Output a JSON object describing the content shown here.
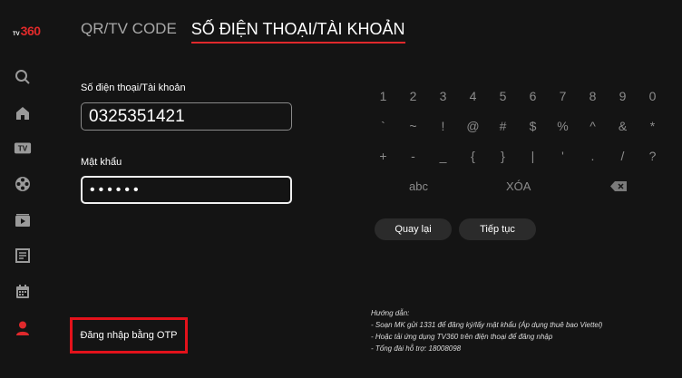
{
  "logo": {
    "prefix": "TV",
    "number": "360"
  },
  "sidebar": {
    "items": [
      {
        "icon": "search-icon",
        "active": false
      },
      {
        "icon": "home-icon",
        "active": false
      },
      {
        "icon": "tv-icon",
        "active": false
      },
      {
        "icon": "film-reel-icon",
        "active": false
      },
      {
        "icon": "video-icon",
        "active": false
      },
      {
        "icon": "news-icon",
        "active": false
      },
      {
        "icon": "calendar-icon",
        "active": false
      },
      {
        "icon": "user-icon",
        "active": true
      }
    ],
    "active_color": "#e0292c"
  },
  "tabs": [
    {
      "label": "QR/TV CODE",
      "active": false
    },
    {
      "label": "SỐ ĐIỆN THOẠI/TÀI KHOẢN",
      "active": true
    }
  ],
  "form": {
    "phone_label": "Số điện thoại/Tài khoản",
    "phone_value": "0325351421",
    "password_label": "Mật khẩu",
    "password_value": "••••••"
  },
  "keyboard": {
    "rows": [
      [
        "1",
        "2",
        "3",
        "4",
        "5",
        "6",
        "7",
        "8",
        "9",
        "0"
      ],
      [
        "`",
        "~",
        "!",
        "@",
        "#",
        "$",
        "%",
        "^",
        "&",
        "*"
      ],
      [
        "+",
        "-",
        "_",
        "{",
        "}",
        "|",
        "'",
        ".",
        "/",
        "?"
      ]
    ],
    "abc_label": "abc",
    "clear_label": "XÓA",
    "backspace_icon": "backspace-icon"
  },
  "buttons": {
    "back_label": "Quay lại",
    "continue_label": "Tiếp tục"
  },
  "otp_login_label": "Đăng nhập bằng OTP",
  "guide": {
    "title": "Hướng dẫn:",
    "lines": [
      "- Soạn MK gửi 1331 để đăng ký/lấy mật khẩu (Áp dụng thuê bao Viettel)",
      "- Hoặc tải ứng dụng TV360 trên điện thoại để đăng nhập",
      "- Tổng đài hỗ trợ: 18008098"
    ]
  },
  "colors": {
    "background": "#141414",
    "accent": "#e0292c",
    "highlight_box": "#e3121b"
  }
}
